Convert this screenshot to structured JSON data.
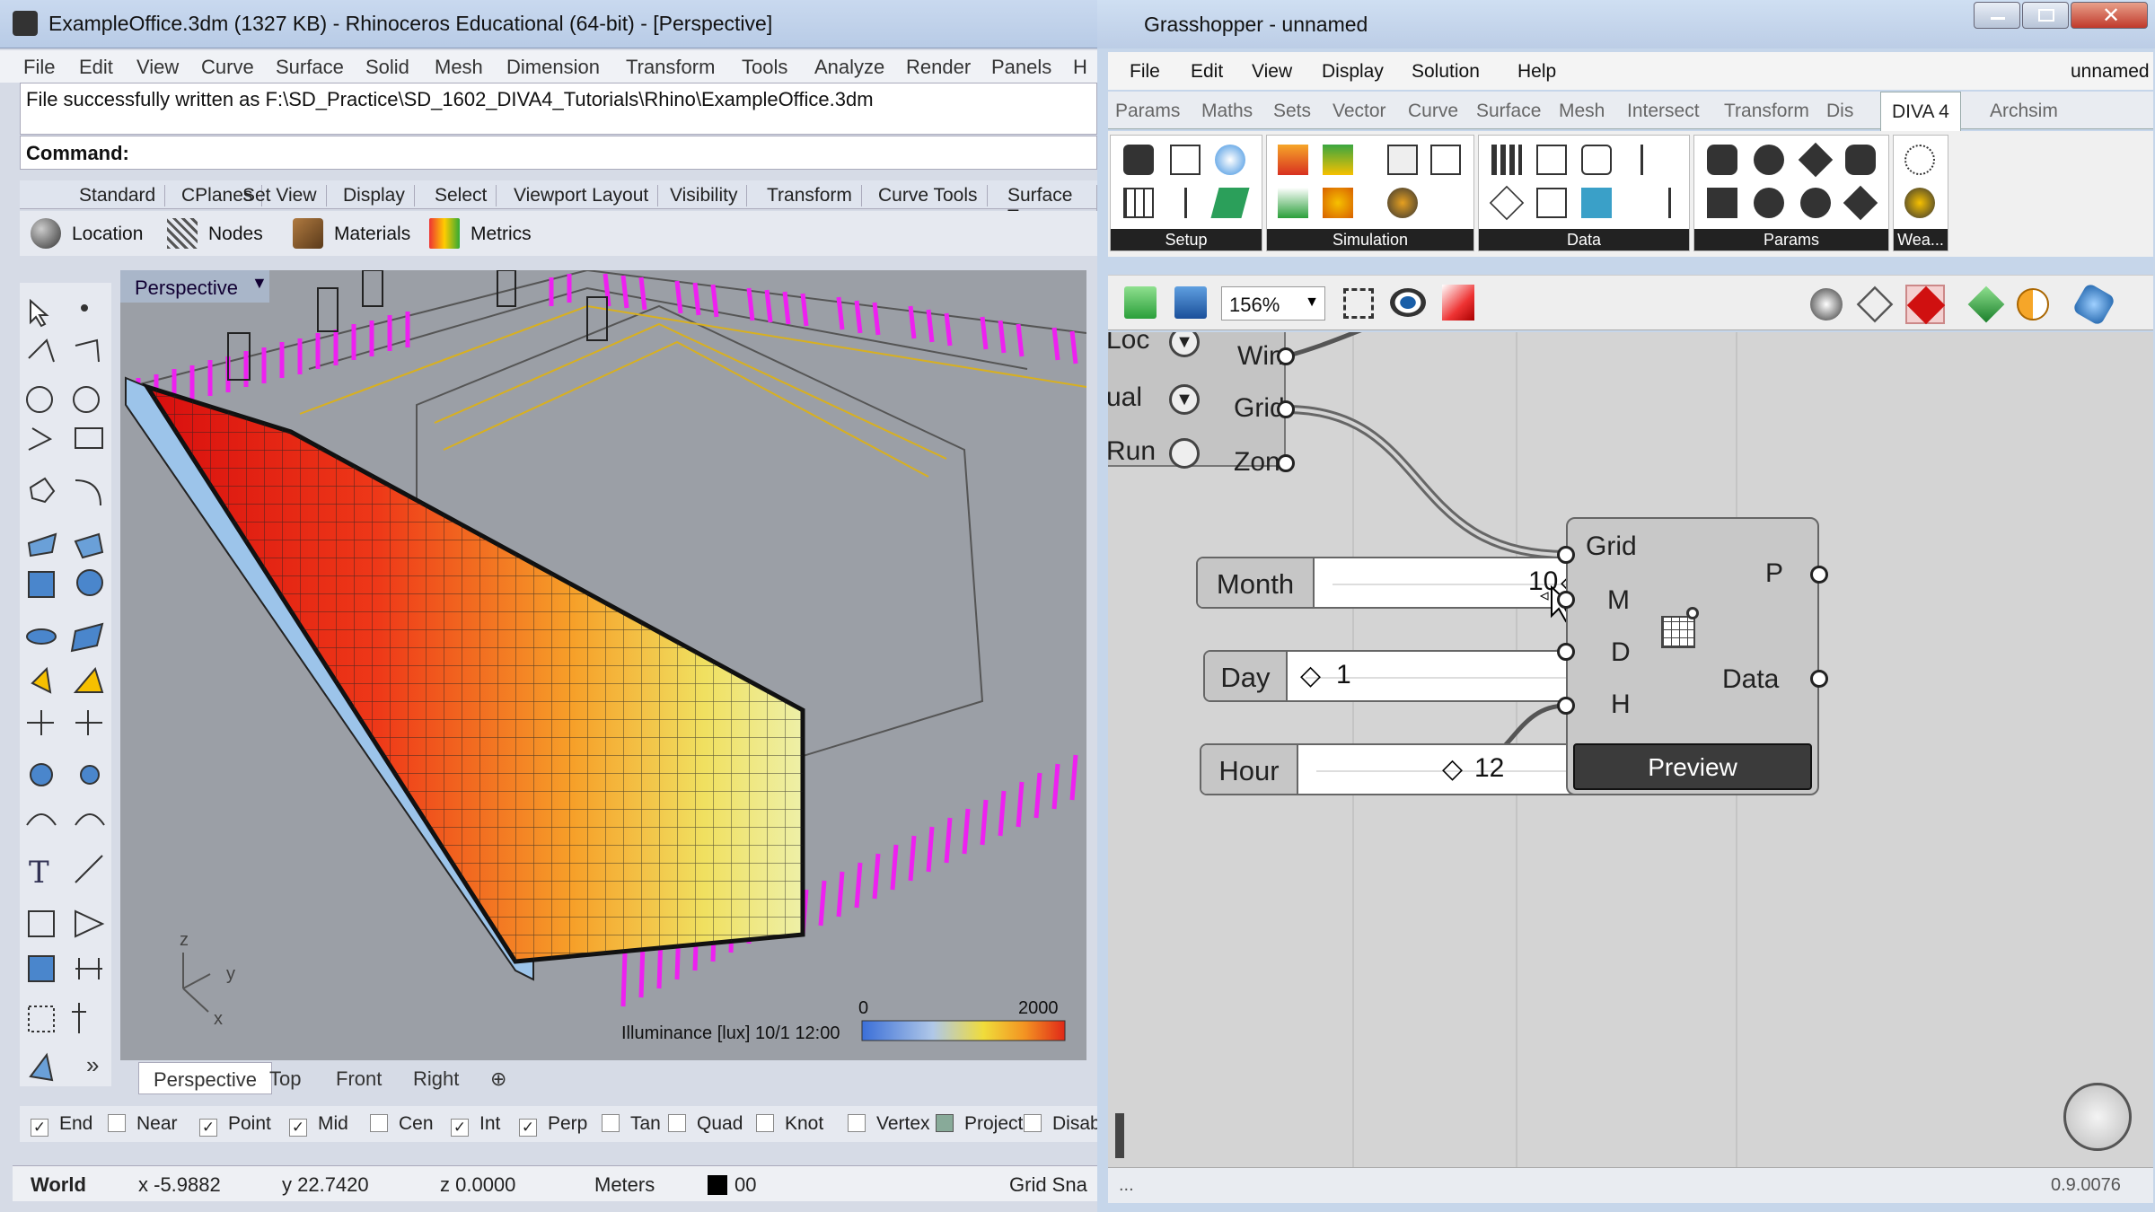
{
  "rhino": {
    "title": "ExampleOffice.3dm (1327 KB) - Rhinoceros Educational (64-bit) - [Perspective]",
    "menu": [
      "File",
      "Edit",
      "View",
      "Curve",
      "Surface",
      "Solid",
      "Mesh",
      "Dimension",
      "Transform",
      "Tools",
      "Analyze",
      "Render",
      "Panels",
      "H"
    ],
    "command_history": "File successfully written as F:\\SD_Practice\\SD_1602_DIVA4_Tutorials\\Rhino\\ExampleOffice.3dm",
    "command_label": "Command:",
    "toolbar_tabs": [
      "Standard",
      "CPlanes",
      "Set View",
      "Display",
      "Select",
      "Viewport Layout",
      "Visibility",
      "Transform",
      "Curve Tools",
      "Surface To"
    ],
    "diva_toolbar": [
      {
        "label": "Location",
        "icon": "globe-icon"
      },
      {
        "label": "Nodes",
        "icon": "nodes-icon"
      },
      {
        "label": "Materials",
        "icon": "materials-icon"
      },
      {
        "label": "Metrics",
        "icon": "metrics-icon"
      }
    ],
    "viewport": {
      "label": "Perspective",
      "legend_min": "0",
      "legend_max": "2000",
      "legend_caption": "Illuminance [lux] 10/1 12:00",
      "axis_z": "z",
      "axis_y": "y",
      "axis_x": "x"
    },
    "viewport_tabs": [
      "Perspective",
      "Top",
      "Front",
      "Right",
      "⊕"
    ],
    "osnaps": [
      {
        "label": "End",
        "checked": true
      },
      {
        "label": "Near",
        "checked": false
      },
      {
        "label": "Point",
        "checked": true
      },
      {
        "label": "Mid",
        "checked": true
      },
      {
        "label": "Cen",
        "checked": false
      },
      {
        "label": "Int",
        "checked": true
      },
      {
        "label": "Perp",
        "checked": true
      },
      {
        "label": "Tan",
        "checked": false
      },
      {
        "label": "Quad",
        "checked": false
      },
      {
        "label": "Knot",
        "checked": false
      },
      {
        "label": "Vertex",
        "checked": false
      },
      {
        "label": "Project",
        "checked": false
      },
      {
        "label": "Disable",
        "checked": false
      }
    ],
    "status": {
      "cplane": "World",
      "x": "x -5.9882",
      "y": "y 22.7420",
      "z": "z 0.0000",
      "units": "Meters",
      "layer": "00",
      "grid": "Grid Sna"
    }
  },
  "gh": {
    "title": "Grasshopper - unnamed",
    "menu": [
      "File",
      "Edit",
      "View",
      "Display",
      "Solution",
      "Help"
    ],
    "doc_name": "unnamed",
    "tabs": [
      "Params",
      "Maths",
      "Sets",
      "Vector",
      "Curve",
      "Surface",
      "Mesh",
      "Intersect",
      "Transform",
      "Dis",
      "DIVA 4",
      "Archsim"
    ],
    "active_tab": "DIVA 4",
    "ribbon_groups": [
      "Setup",
      "Simulation",
      "Data",
      "Params",
      "Wea..."
    ],
    "zoom": "156%",
    "canvas": {
      "partial_inputs": [
        "Loc",
        "ual",
        "Run"
      ],
      "partial_outputs": [
        "Win",
        "Grid",
        "Zone"
      ],
      "sliders": [
        {
          "name": "Month",
          "value": "10"
        },
        {
          "name": "Day",
          "value": "1"
        },
        {
          "name": "Hour",
          "value": "12"
        }
      ],
      "component_inputs": [
        "Grid",
        "M",
        "D",
        "H"
      ],
      "component_outputs": [
        "P",
        "Data"
      ],
      "preview_button": "Preview"
    },
    "status_left": "...",
    "version": "0.9.0076"
  }
}
